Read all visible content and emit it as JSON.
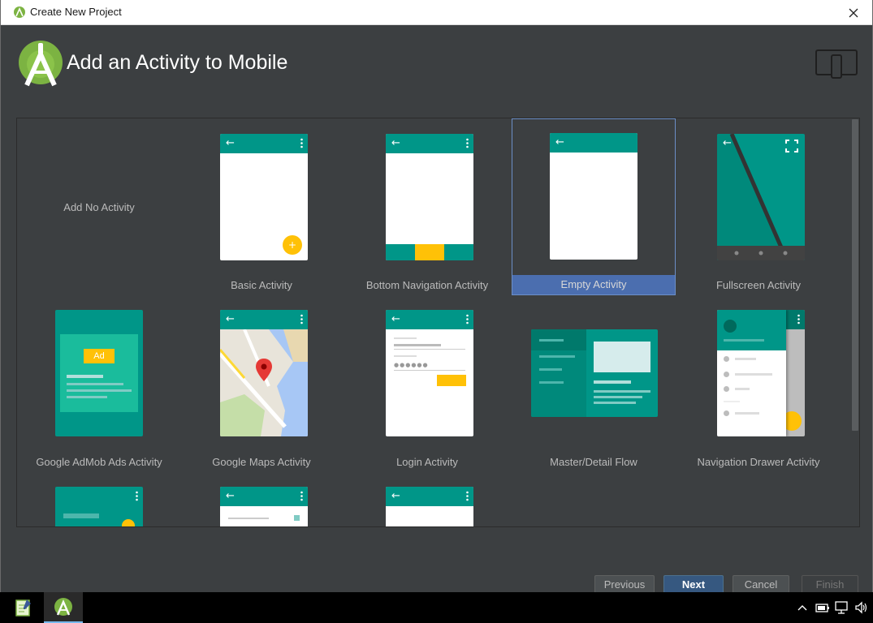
{
  "window": {
    "title": "Create New Project"
  },
  "header": {
    "title": "Add an Activity to Mobile"
  },
  "gallery": {
    "tiles": [
      {
        "label": "Add No Activity"
      },
      {
        "label": "Basic Activity"
      },
      {
        "label": "Bottom Navigation Activity"
      },
      {
        "label": "Empty Activity",
        "selected": true
      },
      {
        "label": "Fullscreen Activity"
      },
      {
        "label": "Google AdMob Ads Activity",
        "ad_badge": "Ad"
      },
      {
        "label": "Google Maps Activity"
      },
      {
        "label": "Login Activity"
      },
      {
        "label": "Master/Detail Flow"
      },
      {
        "label": "Navigation Drawer Activity"
      }
    ]
  },
  "footer": {
    "previous": "Previous",
    "next": "Next",
    "cancel": "Cancel",
    "finish": "Finish"
  },
  "colors": {
    "accent_teal": "#009688",
    "fab_yellow": "#ffc107",
    "selection_blue": "#4b6eaf",
    "dialog_bg": "#3c3f41"
  },
  "icons": {
    "app": "android-studio-icon",
    "device": "mobile-device-icon",
    "close": "close-icon"
  }
}
